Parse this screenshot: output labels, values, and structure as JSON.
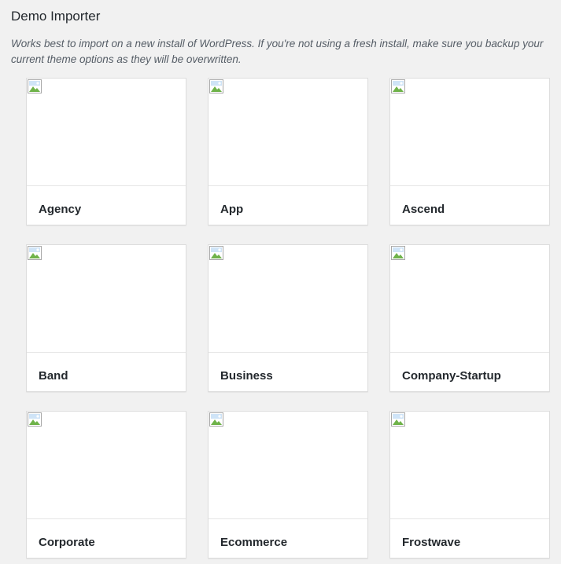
{
  "header": {
    "title": "Demo Importer",
    "description": "Works best to import on a new install of WordPress. If you're not using a fresh install, make sure you backup your current theme options as they will be overwritten."
  },
  "demos": [
    {
      "name": "Agency"
    },
    {
      "name": "App"
    },
    {
      "name": "Ascend"
    },
    {
      "name": "Band"
    },
    {
      "name": "Business"
    },
    {
      "name": "Company-Startup"
    },
    {
      "name": "Corporate"
    },
    {
      "name": "Ecommerce"
    },
    {
      "name": "Frostwave"
    }
  ],
  "icons": {
    "screenshot": "broken-image-icon"
  },
  "colors": {
    "background": "#f1f1f1",
    "card": "#ffffff",
    "border": "#dddddd",
    "text": "#23282d",
    "description": "#555d66"
  }
}
